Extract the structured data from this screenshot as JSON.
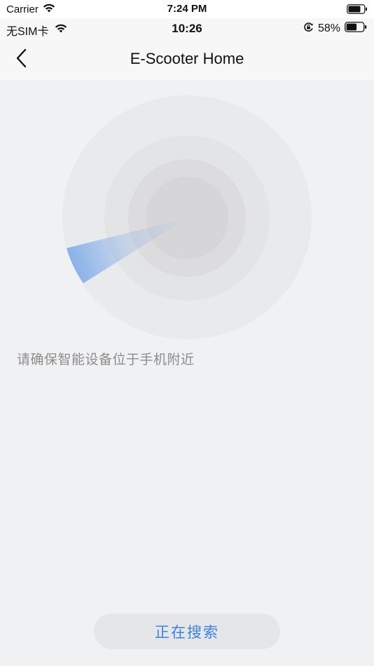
{
  "outer_status": {
    "carrier": "Carrier",
    "time": "7:24 PM"
  },
  "inner_status": {
    "sim": "无SIM卡",
    "time": "10:26",
    "battery_percent": "58%"
  },
  "nav": {
    "title": "E-Scooter Home"
  },
  "main": {
    "hint": "请确保智能设备位于手机附近",
    "search_button_label": "正在搜索"
  },
  "colors": {
    "accent": "#3a82e6",
    "background": "#f0f1f3",
    "hint_text": "#8c8c8c"
  }
}
